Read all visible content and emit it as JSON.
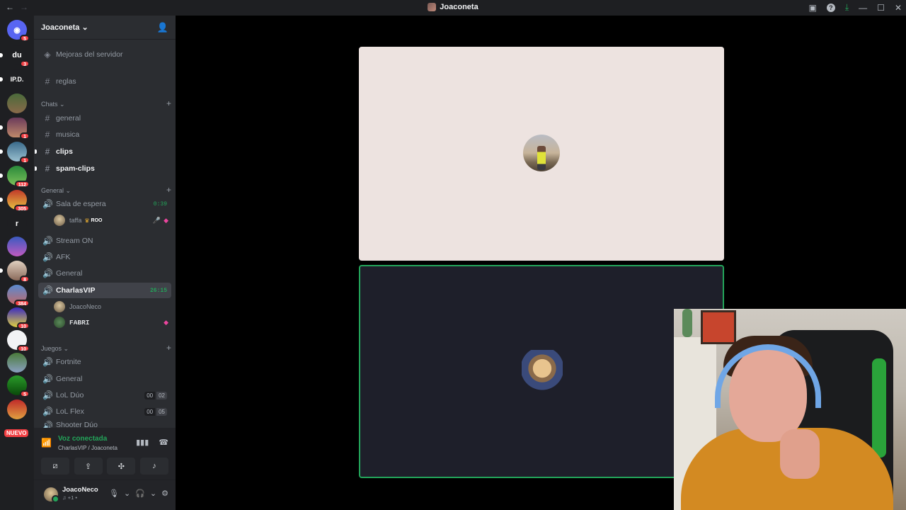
{
  "window": {
    "title": "Joaconeta",
    "nav_back": "←",
    "nav_forward": "→",
    "controls": {
      "minimize": "—",
      "maximize": "☐",
      "close": "✕"
    }
  },
  "server_rail": {
    "items": [
      {
        "label": "du",
        "badge": "3"
      },
      {
        "label": "IP.D.",
        "badge": ""
      },
      {
        "label": "",
        "badge": ""
      },
      {
        "label": "",
        "badge": "1"
      },
      {
        "label": "",
        "badge": "1"
      },
      {
        "label": "",
        "badge": "112"
      },
      {
        "label": "",
        "badge": "305"
      },
      {
        "label": "r",
        "badge": ""
      },
      {
        "label": "",
        "badge": ""
      },
      {
        "label": "",
        "badge": "8"
      },
      {
        "label": "",
        "badge": "384"
      },
      {
        "label": "",
        "badge": "10"
      },
      {
        "label": "",
        "badge": "10"
      },
      {
        "label": "",
        "badge": ""
      },
      {
        "label": "",
        "badge": "5"
      }
    ],
    "home_badge": "5",
    "nuevo": "NUEVO"
  },
  "server": {
    "name": "Joaconeta",
    "dropdown": "⌄",
    "boost": "Mejoras del servidor"
  },
  "channels": {
    "reglas": "reglas",
    "cat_chats": "Chats",
    "general": "general",
    "musica": "musica",
    "clips": "clips",
    "spam_clips": "spam-clips",
    "cat_general": "General",
    "sala": "Sala de espera",
    "sala_time": "0:39",
    "sala_user": "taffa",
    "sala_user_tag": "ROO",
    "stream_on": "Stream ON",
    "afk": "AFK",
    "general_voice": "General",
    "charlas": "CharlasVIP",
    "charlas_time": "26:15",
    "charlas_user1": "JoacoNeco",
    "charlas_user2": "FABRI",
    "cat_juegos": "Juegos",
    "fortnite": "Fortnite",
    "general_juegos": "General",
    "lol_duo": "LoL Dúo",
    "lol_duo_counts": [
      "00",
      "02"
    ],
    "lol_flex": "LoL Flex",
    "lol_flex_counts": [
      "00",
      "05"
    ],
    "shooter": "Shooter Dúo"
  },
  "voice": {
    "status": "Voz conectada",
    "location": "CharlasVIP / Joaconeta"
  },
  "user": {
    "name": "JoacoNeco",
    "status": "♫ +1 •"
  },
  "colors": {
    "accent_green": "#23a55a",
    "badge_red": "#f23f43",
    "sidebar": "#2b2d31",
    "rail": "#1e1f22"
  }
}
